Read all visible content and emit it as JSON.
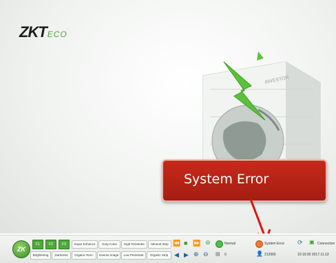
{
  "brand": {
    "logo_main": "ZKT",
    "logo_eco": "ECO"
  },
  "callout": {
    "text": "System Error"
  },
  "toolbar": {
    "zk_label": "ZK",
    "f_buttons": [
      "F1",
      "F2",
      "F3"
    ],
    "row1_modes": [
      "Super Enhance",
      "Gray-Color",
      "High Penetrate",
      "Mineral Strip"
    ],
    "row2_modes": [
      "Brightening",
      "Darkness",
      "Organic Rem.",
      "Inverse Image",
      "Low Penetrate",
      "Organic Strip"
    ],
    "status_normal": "Normal",
    "status_error": "System Error",
    "counter_value": "0",
    "user_id": "213965",
    "connection_label": "Connection",
    "datetime": "10:19:30  2017.11.13"
  },
  "icons": {
    "rewind": "rewind-icon",
    "stop": "stop-icon",
    "forward": "fast-forward-icon",
    "left": "arrow-left-icon",
    "right": "arrow-right-icon",
    "zoom_in": "zoom-in-icon",
    "zoom_out": "zoom-out-icon"
  },
  "colors": {
    "callout_bg": "#b52214",
    "brand_green": "#4aa436",
    "error_orange": "#f07a2a"
  }
}
